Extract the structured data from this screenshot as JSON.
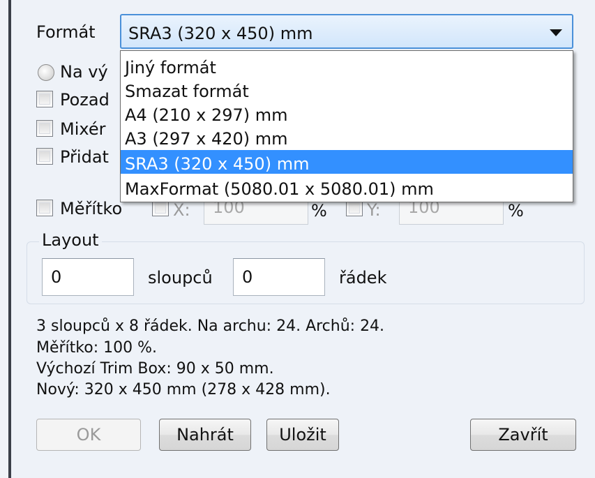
{
  "format": {
    "label": "Formát",
    "selected": "SRA3 (320 x 450) mm",
    "options": [
      "Jiný formát",
      "Smazat formát",
      "A4 (210 x 297) mm",
      "A3 (297 x 420) mm",
      "SRA3 (320 x 450) mm",
      "MaxFormat (5080.01 x 5080.01) mm"
    ]
  },
  "options_partial": {
    "radio_label": "Na vý",
    "check1": "Pozad",
    "check2": "Mixér",
    "check3": "Přidat"
  },
  "scale": {
    "label": "Měřítko",
    "x_label": "X:",
    "x_value": "100",
    "x_unit": "%",
    "y_label": "Y:",
    "y_value": "100",
    "y_unit": "%"
  },
  "layout": {
    "title": "Layout",
    "columns_value": "0",
    "columns_label": "sloupců",
    "rows_value": "0",
    "rows_label": "řádek"
  },
  "info": {
    "line1": "3 sloupců x 8 řádek. Na archu: 24. Archů: 24.",
    "line2": "Měřítko: 100 %.",
    "line3": "Výchozí Trim Box: 90 x 50 mm.",
    "line4": "Nový: 320 x 450 mm (278 x 428 mm)."
  },
  "buttons": {
    "ok": "OK",
    "load": "Nahrát",
    "save": "Uložit",
    "close": "Zavřít"
  }
}
